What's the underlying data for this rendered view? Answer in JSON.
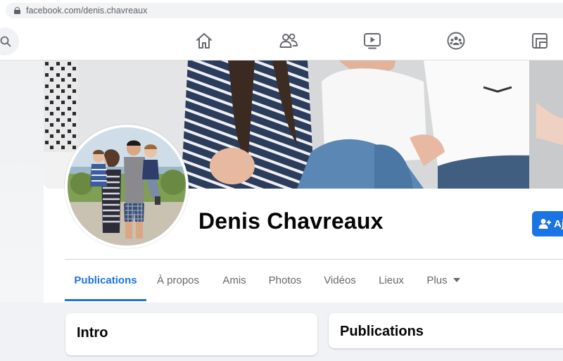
{
  "browser": {
    "url": "facebook.com/denis.chavreaux"
  },
  "nav": {
    "icons": [
      "search-icon",
      "home-icon",
      "friends-icon",
      "watch-icon",
      "groups-icon",
      "gaming-icon"
    ]
  },
  "profile": {
    "name": "Denis Chavreaux",
    "add_button_label": "Aj"
  },
  "tabs": [
    {
      "label": "Publications",
      "active": true
    },
    {
      "label": "À propos"
    },
    {
      "label": "Amis"
    },
    {
      "label": "Photos"
    },
    {
      "label": "Vidéos"
    },
    {
      "label": "Lieux"
    },
    {
      "label": "Plus"
    }
  ],
  "cards": {
    "intro_title": "Intro",
    "posts_title": "Publications"
  },
  "colors": {
    "accent": "#1b74e4",
    "page_bg": "#f0f2f5",
    "text_secondary": "#65676b"
  }
}
